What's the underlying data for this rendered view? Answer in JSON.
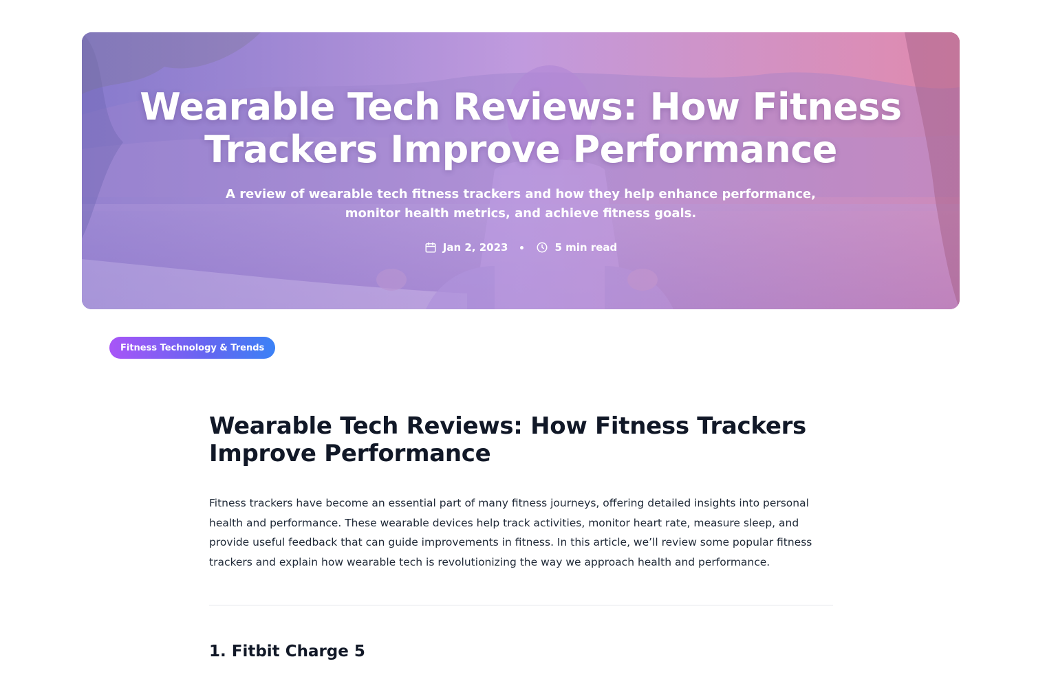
{
  "hero": {
    "title": "Wearable Tech Reviews: How Fitness Trackers Improve Performance",
    "subtitle": "A review of wearable tech fitness trackers and how they help enhance performance, monitor health metrics, and achieve fitness goals.",
    "date": "Jan 2, 2023",
    "read_time": "5 min read",
    "date_icon": "calendar-icon",
    "time_icon": "clock-icon"
  },
  "category": {
    "label": "Fitness Technology & Trends"
  },
  "article": {
    "title": "Wearable Tech Reviews: How Fitness Trackers Improve Performance",
    "intro": "Fitness trackers have become an essential part of many fitness journeys, offering detailed insights into personal health and performance. These wearable devices help track activities, monitor heart rate, measure sleep, and provide useful feedback that can guide improvements in fitness. In this article, we’ll review some popular fitness trackers and explain how wearable tech is revolutionizing the way we approach health and performance.",
    "section_1_heading": "1. Fitbit Charge 5"
  },
  "colors": {
    "pill_gradient_start": "#a855f7",
    "pill_gradient_end": "#3b82f6",
    "text_primary": "#111827",
    "divider": "#e5e7eb"
  }
}
